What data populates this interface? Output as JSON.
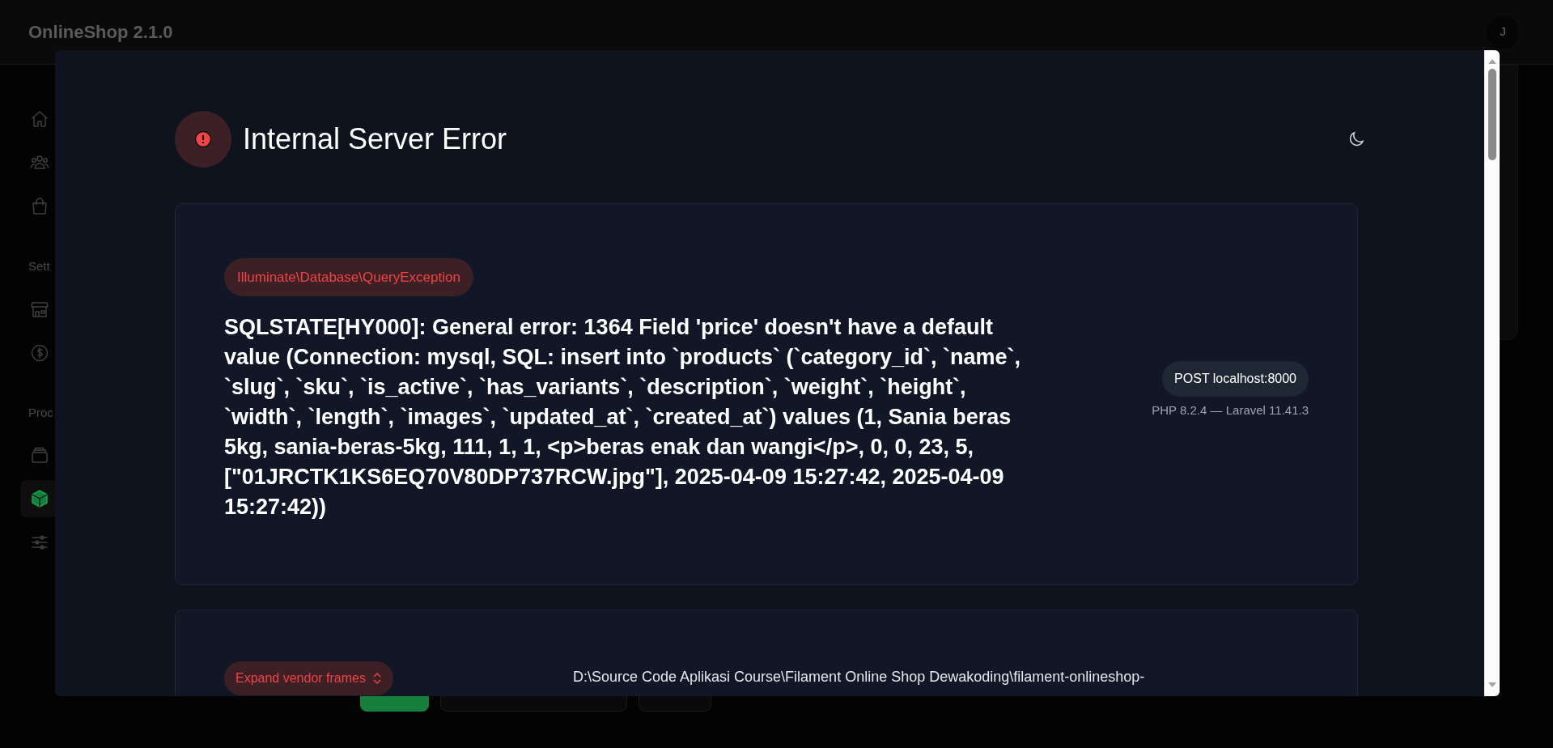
{
  "app": {
    "title": "OnlineShop 2.1.0",
    "avatar_initial": "J"
  },
  "sidebar": {
    "groups": [
      {
        "items": [
          {
            "selected": false
          },
          {
            "selected": false
          },
          {
            "selected": false
          }
        ]
      },
      {
        "label": "Sett",
        "items": [
          {
            "selected": false
          },
          {
            "selected": false
          }
        ]
      },
      {
        "label": "Proc",
        "items": [
          {
            "selected": false
          },
          {
            "selected": true
          },
          {
            "selected": false
          }
        ]
      }
    ]
  },
  "form_buttons": [
    {
      "kind": "primary"
    },
    {
      "kind": "secondary"
    },
    {
      "kind": "secondary"
    }
  ],
  "error_page": {
    "title": "Internal Server Error",
    "exception_class": "Illuminate\\Database\\QueryException",
    "message": "SQLSTATE[HY000]: General error: 1364 Field 'price' doesn't have a default value (Connection: mysql, SQL: insert into `products` (`category_id`, `name`, `slug`, `sku`, `is_active`, `has_variants`, `description`, `weight`, `height`, `width`, `length`, `images`, `updated_at`, `created_at`) values (1, Sania beras 5kg, sania-beras-5kg, 111, 1, 1, <p>beras enak dan wangi</p>, 0, 0, 23, 5, [\"01JRCTK1KS6EQ70V80DP737RCW.jpg\"], 2025-04-09 15:27:42, 2025-04-09 15:27:42))",
    "request": "POST localhost:8000",
    "versions": "PHP 8.2.4 — Laravel 11.41.3",
    "frames_toggle": "Expand vendor frames",
    "frame_path": "D:\\Source Code Aplikasi Course\\Filament Online Shop Dewakoding\\filament-onlineshop-"
  }
}
